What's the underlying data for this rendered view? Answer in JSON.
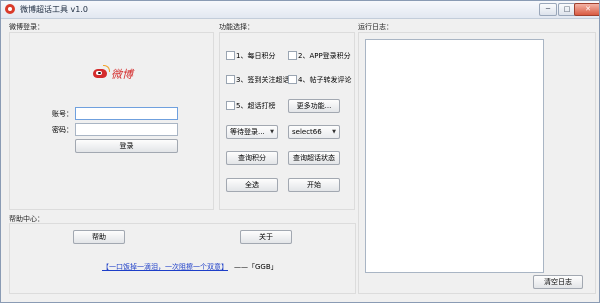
{
  "window": {
    "title": "微博超话工具 v1.0",
    "controls": {
      "minimize": "─",
      "maximize": "□",
      "close": "✕"
    }
  },
  "login": {
    "section_title": "微博登录：",
    "logo_text": "微博",
    "account_label": "账号：",
    "account_value": "",
    "password_label": "密码：",
    "password_value": "",
    "login_button": "登录"
  },
  "functions": {
    "section_title": "功能选择：",
    "options": [
      {
        "label": "1、每日积分",
        "checked": false
      },
      {
        "label": "2、APP登录积分",
        "checked": false
      },
      {
        "label": "3、签到关注超话",
        "checked": false
      },
      {
        "label": "4、帖子转发评论",
        "checked": false
      },
      {
        "label": "5、超话打榜",
        "checked": false
      }
    ],
    "more_button": "更多功能...",
    "dropdown_wait": "等待登录...",
    "dropdown_select": "select66",
    "query_points_button": "查询积分",
    "query_status_button": "查询超话状态",
    "select_all_button": "全选",
    "start_button": "开始"
  },
  "help": {
    "section_title": "帮助中心：",
    "help_button": "帮助",
    "about_button": "关于",
    "link_text": "【一口饭掉一滴泪，一次阻擦一个双意】",
    "suffix_text": "——「GGB」"
  },
  "log": {
    "section_title": "运行日志：",
    "clear_button": "清空日志"
  }
}
